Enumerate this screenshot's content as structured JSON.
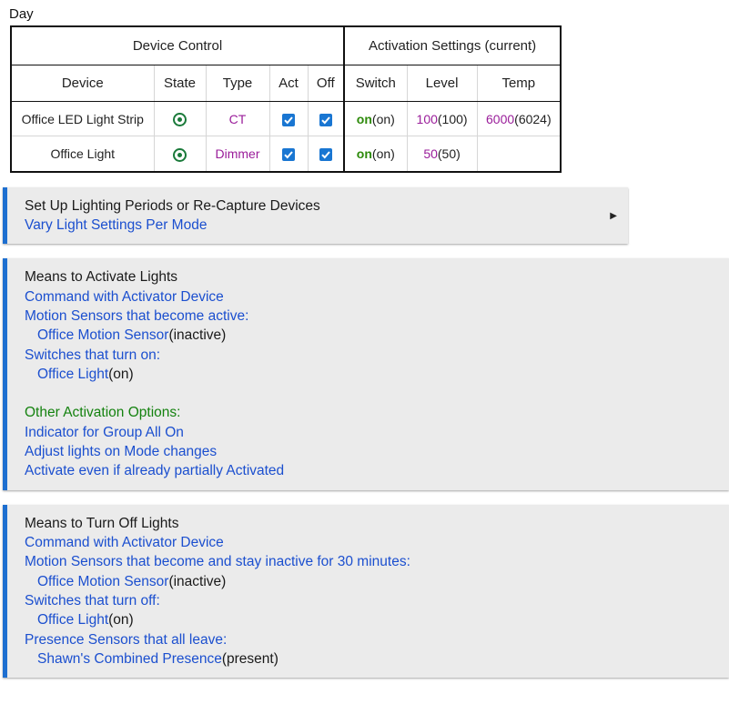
{
  "page_title": "Day",
  "table": {
    "group_device_control": "Device Control",
    "group_activation": "Activation Settings (current)",
    "columns": [
      "Device",
      "State",
      "Type",
      "Act",
      "Off",
      "Switch",
      "Level",
      "Temp"
    ],
    "rows": [
      {
        "device": "Office LED Light Strip",
        "type": "CT",
        "act": true,
        "off": true,
        "switch": "on",
        "switch_cur": "(on)",
        "level": "100",
        "level_cur": "(100)",
        "temp": "6000",
        "temp_cur": "(6024)"
      },
      {
        "device": "Office Light",
        "type": "Dimmer",
        "act": true,
        "off": true,
        "switch": "on",
        "switch_cur": "(on)",
        "level": "50",
        "level_cur": "(50)",
        "temp": "",
        "temp_cur": ""
      }
    ]
  },
  "setup_panel": {
    "title": "Set Up Lighting Periods or Re-Capture Devices",
    "link": "Vary Light Settings Per Mode"
  },
  "activate_panel": {
    "title": "Means to Activate Lights",
    "command": "Command with Activator Device",
    "motion_label": "Motion Sensors that become active:",
    "motion_device": "Office Motion Sensor",
    "motion_state": "(inactive)",
    "switch_label": "Switches that turn on:",
    "switch_device": "Office Light",
    "switch_state": "(on)",
    "other_options": "Other Activation Options:",
    "indicator": "Indicator for Group All On",
    "adjust": "Adjust lights on Mode changes",
    "activate_even": "Activate even if already partially Activated"
  },
  "off_panel": {
    "title": "Means to Turn Off Lights",
    "command": "Command with Activator Device",
    "motion_label": "Motion Sensors that become and stay inactive for 30 minutes:",
    "motion_device": "Office Motion Sensor",
    "motion_state": "(inactive)",
    "switch_label": "Switches that turn off:",
    "switch_device": "Office Light",
    "switch_state": "(on)",
    "presence_label": "Presence Sensors that all leave:",
    "presence_device": "Shawn's Combined Presence",
    "presence_state": "(present)"
  },
  "colors": {
    "accent": "#1e6fd0",
    "link": "#1b4fcf",
    "state_green": "#2d8a0a",
    "value_purple": "#9a1d9a",
    "checkbox": "#1976d2"
  }
}
